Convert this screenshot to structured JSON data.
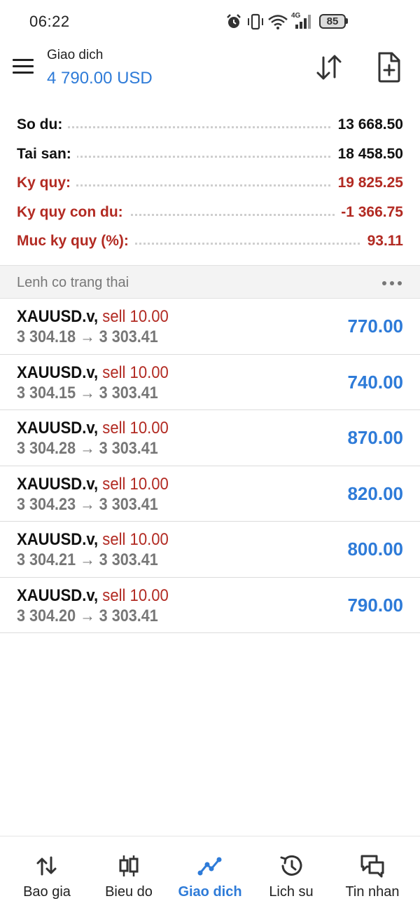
{
  "status_bar": {
    "time": "06:22",
    "network": "4G",
    "battery": "85"
  },
  "header": {
    "title": "Giao dich",
    "subtitle": "4 790.00 USD"
  },
  "summary": [
    {
      "label": "So du:",
      "value": "13 668.50",
      "color": "black"
    },
    {
      "label": "Tai san:",
      "value": "18 458.50",
      "color": "black"
    },
    {
      "label": "Ky quy:",
      "value": "19 825.25",
      "color": "red"
    },
    {
      "label": "Ky quy con du:",
      "value": "-1 366.75",
      "color": "red"
    },
    {
      "label": "Muc ky quy (%):",
      "value": "93.11",
      "color": "red"
    }
  ],
  "section": {
    "title": "Lenh co trang thai"
  },
  "orders": [
    {
      "symbol": "XAUUSD.v,",
      "side": "sell 10.00",
      "prices": "3 304.18 → 3 303.41",
      "profit": "770.00"
    },
    {
      "symbol": "XAUUSD.v,",
      "side": "sell 10.00",
      "prices": "3 304.15 → 3 303.41",
      "profit": "740.00"
    },
    {
      "symbol": "XAUUSD.v,",
      "side": "sell 10.00",
      "prices": "3 304.28 → 3 303.41",
      "profit": "870.00"
    },
    {
      "symbol": "XAUUSD.v,",
      "side": "sell 10.00",
      "prices": "3 304.23 → 3 303.41",
      "profit": "820.00"
    },
    {
      "symbol": "XAUUSD.v,",
      "side": "sell 10.00",
      "prices": "3 304.21 → 3 303.41",
      "profit": "800.00"
    },
    {
      "symbol": "XAUUSD.v,",
      "side": "sell 10.00",
      "prices": "3 304.20 → 3 303.41",
      "profit": "790.00"
    }
  ],
  "nav": [
    {
      "label": "Bao gia",
      "icon": "quotes-icon"
    },
    {
      "label": "Bieu do",
      "icon": "chart-candles-icon"
    },
    {
      "label": "Giao dich",
      "icon": "trade-icon",
      "active": true
    },
    {
      "label": "Lich su",
      "icon": "history-icon"
    },
    {
      "label": "Tin nhan",
      "icon": "messages-icon"
    }
  ],
  "colors": {
    "accent": "#2e7bd8",
    "loss": "#b22a22",
    "muted": "#777777"
  }
}
